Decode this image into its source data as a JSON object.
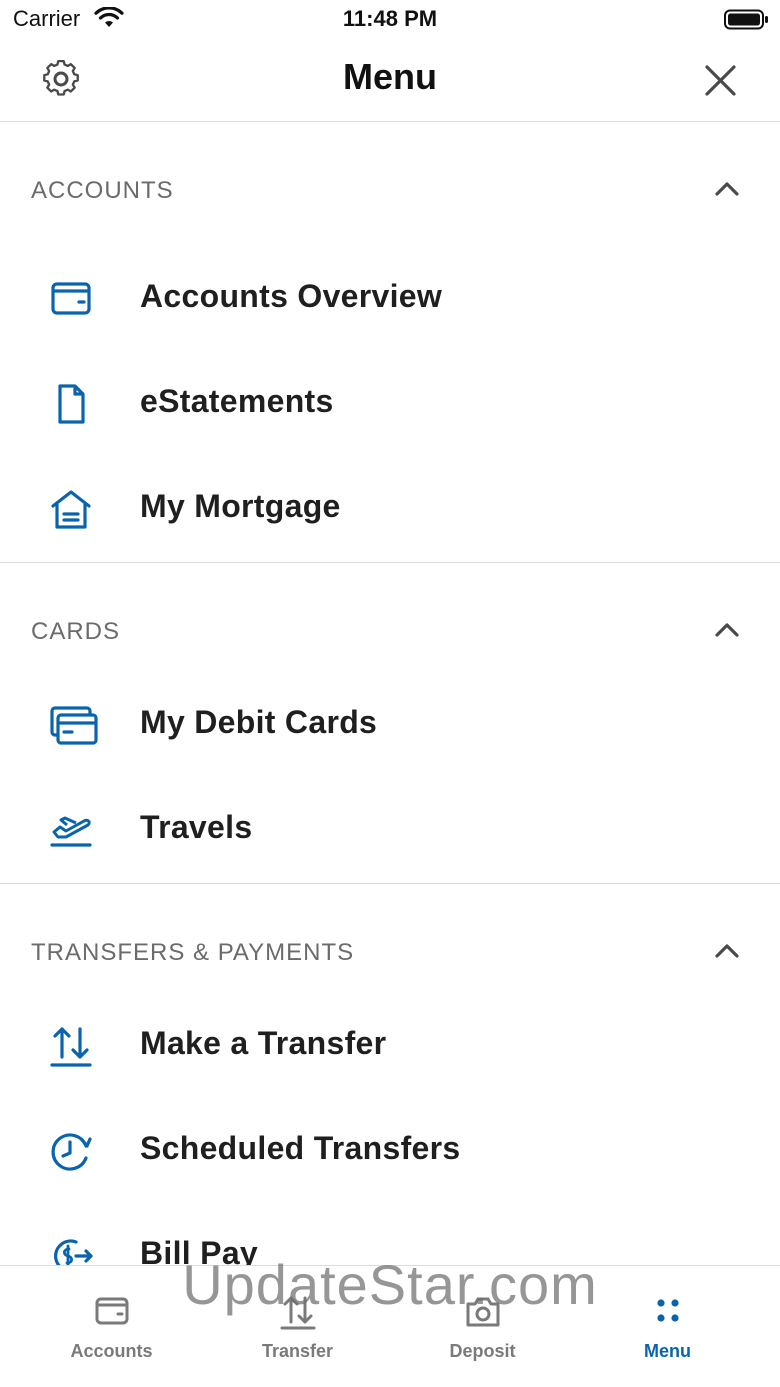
{
  "status_bar": {
    "carrier": "Carrier",
    "time": "11:48 PM"
  },
  "header": {
    "title": "Menu"
  },
  "colors": {
    "accent": "#0a64ad",
    "icon": "#0a64ad",
    "section_title": "#6b6b6b",
    "divider": "#dcdcdc"
  },
  "sections": [
    {
      "title": "ACCOUNTS",
      "expanded": true,
      "items": [
        {
          "label": "Accounts Overview",
          "icon": "wallet-icon"
        },
        {
          "label": "eStatements",
          "icon": "document-icon"
        },
        {
          "label": "My Mortgage",
          "icon": "house-icon"
        }
      ]
    },
    {
      "title": "CARDS",
      "expanded": true,
      "items": [
        {
          "label": "My Debit Cards",
          "icon": "cards-icon"
        },
        {
          "label": "Travels",
          "icon": "airplane-icon"
        }
      ]
    },
    {
      "title": "TRANSFERS & PAYMENTS",
      "expanded": true,
      "items": [
        {
          "label": "Make a Transfer",
          "icon": "transfer-arrows-icon"
        },
        {
          "label": "Scheduled Transfers",
          "icon": "scheduled-clock-icon"
        },
        {
          "label": "Bill Pay",
          "icon": "bill-pay-icon"
        }
      ]
    }
  ],
  "tab_bar": {
    "tabs": [
      {
        "label": "Accounts",
        "icon": "wallet-icon",
        "active": false
      },
      {
        "label": "Transfer",
        "icon": "transfer-arrows-icon",
        "active": false
      },
      {
        "label": "Deposit",
        "icon": "camera-icon",
        "active": false
      },
      {
        "label": "Menu",
        "icon": "menu-dots-icon",
        "active": true
      }
    ]
  },
  "watermark": "UpdateStar.com"
}
